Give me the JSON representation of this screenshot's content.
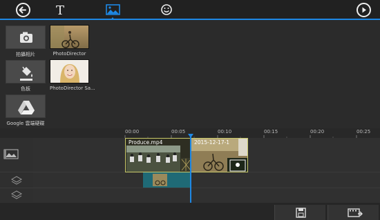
{
  "toolbar": {
    "back_icon": "arrow-left-icon",
    "tabs": [
      {
        "name": "text-tab",
        "icon": "text-T-icon"
      },
      {
        "name": "image-tab",
        "icon": "image-icon",
        "active": true
      },
      {
        "name": "sticker-tab",
        "icon": "smiley-icon"
      }
    ],
    "play_icon": "play-icon",
    "accent": "#1e88e5"
  },
  "library": {
    "items": [
      {
        "label": "拍攝相片",
        "icon": "camera-icon"
      },
      {
        "label": "PhotoDirector",
        "icon": "photo-thumb"
      },
      {
        "label": "色板",
        "icon": "paint-bucket-icon"
      },
      {
        "label": "PhotoDirector Sa...",
        "icon": "portrait-thumb"
      },
      {
        "label": "Google 雲端硬碟",
        "icon": "google-drive-icon"
      }
    ]
  },
  "timeline": {
    "ticks": [
      "00:00",
      "00:05",
      "00:10",
      "00:15",
      "00:20",
      "00:25"
    ],
    "clips": [
      {
        "label": "Produce.mp4"
      },
      {
        "label": "2015-12-17-1"
      }
    ]
  },
  "bottom_bar": {
    "save_icon": "save-icon",
    "export_icon": "export-video-icon"
  }
}
